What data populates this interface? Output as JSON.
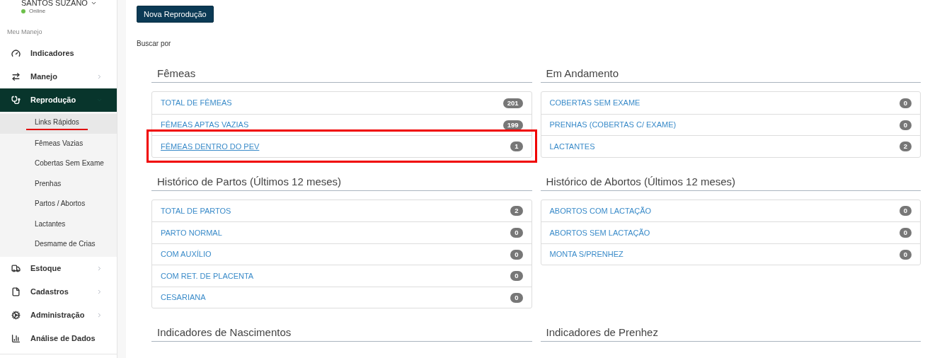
{
  "profile": {
    "name": "SANTOS SUZANO",
    "status": "Online",
    "online": true
  },
  "sidebar": {
    "section_label": "Meu Manejo",
    "items": [
      {
        "label": "Indicadores",
        "has_submenu": false,
        "selected": false
      },
      {
        "label": "Manejo",
        "has_submenu": true,
        "selected": false
      },
      {
        "label": "Reprodução",
        "has_submenu": true,
        "selected": true,
        "expanded": true,
        "children": [
          {
            "label": "Links Rápidos",
            "selected": true,
            "highlighted": true
          },
          {
            "label": "Fêmeas Vazias",
            "selected": false,
            "highlighted": false
          },
          {
            "label": "Cobertas Sem Exame",
            "selected": false,
            "highlighted": false
          },
          {
            "label": "Prenhas",
            "selected": false,
            "highlighted": false
          },
          {
            "label": "Partos / Abortos",
            "selected": false,
            "highlighted": false
          },
          {
            "label": "Lactantes",
            "selected": false,
            "highlighted": false
          },
          {
            "label": "Desmame de Crias",
            "selected": false,
            "highlighted": false
          }
        ]
      },
      {
        "label": "Estoque",
        "has_submenu": true,
        "selected": false
      },
      {
        "label": "Cadastros",
        "has_submenu": true,
        "selected": false
      },
      {
        "label": "Administração",
        "has_submenu": true,
        "selected": false
      },
      {
        "label": "Análise de Dados",
        "has_submenu": false,
        "selected": false
      }
    ]
  },
  "new_button": "Nova Reprodução",
  "search_label": "Buscar por",
  "panels": [
    {
      "title": "Fêmeas",
      "items": [
        {
          "label": "TOTAL DE FÊMEAS",
          "count": "201",
          "hovered": false,
          "highlighted": false
        },
        {
          "label": "FÊMEAS APTAS VAZIAS",
          "count": "199",
          "hovered": false,
          "highlighted": false
        },
        {
          "label": "FÊMEAS DENTRO DO PEV",
          "count": "1",
          "hovered": true,
          "highlighted": true
        }
      ]
    },
    {
      "title": "Em Andamento",
      "items": [
        {
          "label": "COBERTAS SEM EXAME",
          "count": "0",
          "hovered": false,
          "highlighted": false
        },
        {
          "label": "PRENHAS (COBERTAS C/ EXAME)",
          "count": "0",
          "hovered": false,
          "highlighted": false
        },
        {
          "label": "LACTANTES",
          "count": "2",
          "hovered": false,
          "highlighted": false
        }
      ]
    },
    {
      "title": "Histórico de Partos (Últimos 12 meses)",
      "items": [
        {
          "label": "TOTAL DE PARTOS",
          "count": "2",
          "hovered": false,
          "highlighted": false
        },
        {
          "label": "PARTO NORMAL",
          "count": "0",
          "hovered": false,
          "highlighted": false
        },
        {
          "label": "COM AUXÍLIO",
          "count": "0",
          "hovered": false,
          "highlighted": false
        },
        {
          "label": "COM RET. DE PLACENTA",
          "count": "0",
          "hovered": false,
          "highlighted": false
        },
        {
          "label": "CESARIANA",
          "count": "0",
          "hovered": false,
          "highlighted": false
        }
      ]
    },
    {
      "title": "Histórico de Abortos (Últimos 12 meses)",
      "items": [
        {
          "label": "ABORTOS COM LACTAÇÃO",
          "count": "0",
          "hovered": false,
          "highlighted": false
        },
        {
          "label": "ABORTOS SEM LACTAÇÃO",
          "count": "0",
          "hovered": false,
          "highlighted": false
        },
        {
          "label": "MONTA S/PRENHEZ",
          "count": "0",
          "hovered": false,
          "highlighted": false
        }
      ]
    },
    {
      "title": "Indicadores de Nascimentos"
    },
    {
      "title": "Indicadores de Prenhez"
    }
  ]
}
